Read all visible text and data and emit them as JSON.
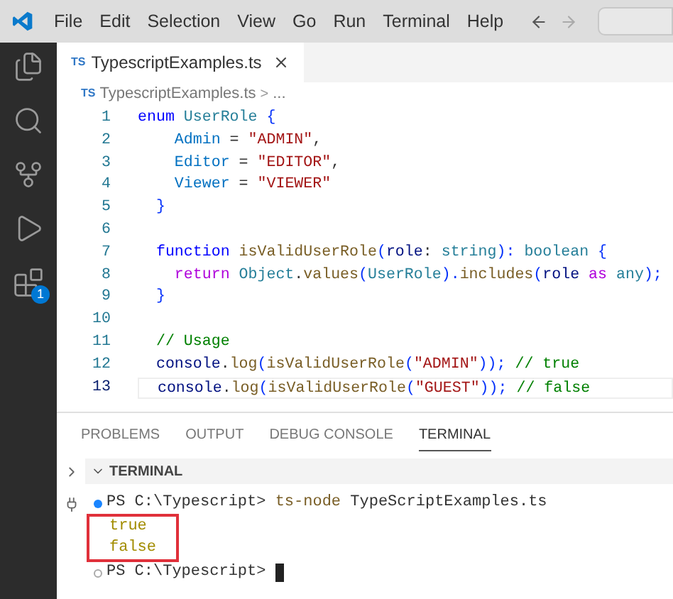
{
  "menu_bar": {
    "items": [
      "File",
      "Edit",
      "Selection",
      "View",
      "Go",
      "Run",
      "Terminal",
      "Help"
    ]
  },
  "activity_bar": {
    "items": [
      {
        "kind": "files",
        "selected": false
      },
      {
        "kind": "search",
        "selected": false
      },
      {
        "kind": "source-control",
        "selected": false
      },
      {
        "kind": "run",
        "selected": false
      },
      {
        "kind": "extensions",
        "selected": false,
        "badge": "1"
      }
    ]
  },
  "editor": {
    "tabs": [
      {
        "label": "TypescriptExamples.ts",
        "file_badge": "TS",
        "selected": true
      }
    ],
    "breadcrumb": {
      "file_badge": "TS",
      "file": "TypescriptExamples.ts",
      "separator": ">",
      "tail": "..."
    },
    "lines": [
      {
        "number": "1",
        "current": false,
        "tokens": [
          {
            "text": "enum",
            "kind": "keyword"
          },
          {
            "text": " UserRole ",
            "kind": "type"
          },
          {
            "text": "{",
            "kind": "bracket"
          }
        ]
      },
      {
        "number": "2",
        "current": false,
        "tokens": [
          {
            "text": "    Admin",
            "kind": "member"
          },
          {
            "text": " = ",
            "kind": "plain"
          },
          {
            "text": "\"ADMIN\"",
            "kind": "string"
          },
          {
            "text": ",",
            "kind": "plain"
          }
        ]
      },
      {
        "number": "3",
        "current": false,
        "tokens": [
          {
            "text": "    Editor",
            "kind": "member"
          },
          {
            "text": " = ",
            "kind": "plain"
          },
          {
            "text": "\"EDITOR\"",
            "kind": "string"
          },
          {
            "text": ",",
            "kind": "plain"
          }
        ]
      },
      {
        "number": "4",
        "current": false,
        "tokens": [
          {
            "text": "    Viewer",
            "kind": "member"
          },
          {
            "text": " = ",
            "kind": "plain"
          },
          {
            "text": "\"VIEWER\"",
            "kind": "string"
          }
        ]
      },
      {
        "number": "5",
        "current": false,
        "tokens": [
          {
            "text": "  }",
            "kind": "bracket"
          }
        ]
      },
      {
        "number": "6",
        "current": false
      },
      {
        "number": "7",
        "current": false,
        "tokens": [
          {
            "text": "  function",
            "kind": "keyword"
          },
          {
            "text": " isValidUserRole",
            "kind": "function"
          },
          {
            "text": "(",
            "kind": "bracket"
          },
          {
            "text": "role",
            "kind": "variable"
          },
          {
            "text": ": ",
            "kind": "plain"
          },
          {
            "text": "string",
            "kind": "type"
          },
          {
            "text": "): ",
            "kind": "bracket"
          },
          {
            "text": "boolean",
            "kind": "type"
          },
          {
            "text": " {",
            "kind": "bracket"
          }
        ]
      },
      {
        "number": "8",
        "current": false,
        "tokens": [
          {
            "text": "    return",
            "kind": "control"
          },
          {
            "text": " Object",
            "kind": "type"
          },
          {
            "text": ".",
            "kind": "plain"
          },
          {
            "text": "values",
            "kind": "function"
          },
          {
            "text": "(",
            "kind": "bracket"
          },
          {
            "text": "UserRole",
            "kind": "type"
          },
          {
            "text": ").",
            "kind": "bracket"
          },
          {
            "text": "includes",
            "kind": "function"
          },
          {
            "text": "(",
            "kind": "bracket"
          },
          {
            "text": "role",
            "kind": "variable"
          },
          {
            "text": " as ",
            "kind": "control"
          },
          {
            "text": "any",
            "kind": "type"
          },
          {
            "text": ");",
            "kind": "bracket"
          }
        ]
      },
      {
        "number": "9",
        "current": false,
        "tokens": [
          {
            "text": "  }",
            "kind": "bracket"
          }
        ]
      },
      {
        "number": "10",
        "current": false
      },
      {
        "number": "11",
        "current": false,
        "tokens": [
          {
            "text": "  // Usage",
            "kind": "comment"
          }
        ]
      },
      {
        "number": "12",
        "current": false,
        "tokens": [
          {
            "text": "  console",
            "kind": "variable"
          },
          {
            "text": ".",
            "kind": "plain"
          },
          {
            "text": "log",
            "kind": "function"
          },
          {
            "text": "(",
            "kind": "bracket"
          },
          {
            "text": "isValidUserRole",
            "kind": "function"
          },
          {
            "text": "(",
            "kind": "bracket"
          },
          {
            "text": "\"ADMIN\"",
            "kind": "string"
          },
          {
            "text": "));",
            "kind": "bracket"
          },
          {
            "text": " // true",
            "kind": "comment"
          }
        ]
      },
      {
        "number": "13",
        "current": true,
        "tokens": [
          {
            "text": "  console",
            "kind": "variable"
          },
          {
            "text": ".",
            "kind": "plain"
          },
          {
            "text": "log",
            "kind": "function"
          },
          {
            "text": "(",
            "kind": "bracket"
          },
          {
            "text": "isValidUserRole",
            "kind": "function"
          },
          {
            "text": "(",
            "kind": "bracket"
          },
          {
            "text": "\"GUEST\"",
            "kind": "string"
          },
          {
            "text": "));",
            "kind": "bracket"
          },
          {
            "text": " // false",
            "kind": "comment"
          }
        ]
      }
    ]
  },
  "panel": {
    "tabs": [
      {
        "label": "PROBLEMS",
        "selected": false
      },
      {
        "label": "OUTPUT",
        "selected": false
      },
      {
        "label": "DEBUG CONSOLE",
        "selected": false
      },
      {
        "label": "TERMINAL",
        "selected": true
      }
    ],
    "section": {
      "title": "TERMINAL",
      "expanded": true
    },
    "terminal": {
      "command": {
        "succeeded": true,
        "prompt": "PS C:\\Typescript>",
        "program": "ts-node",
        "args": "TypeScriptExamples.ts"
      },
      "output": {
        "lines": [
          "true",
          "false"
        ],
        "highlighted": true
      },
      "prompt": {
        "succeeded": false,
        "text": "PS C:\\Typescript>"
      }
    }
  }
}
